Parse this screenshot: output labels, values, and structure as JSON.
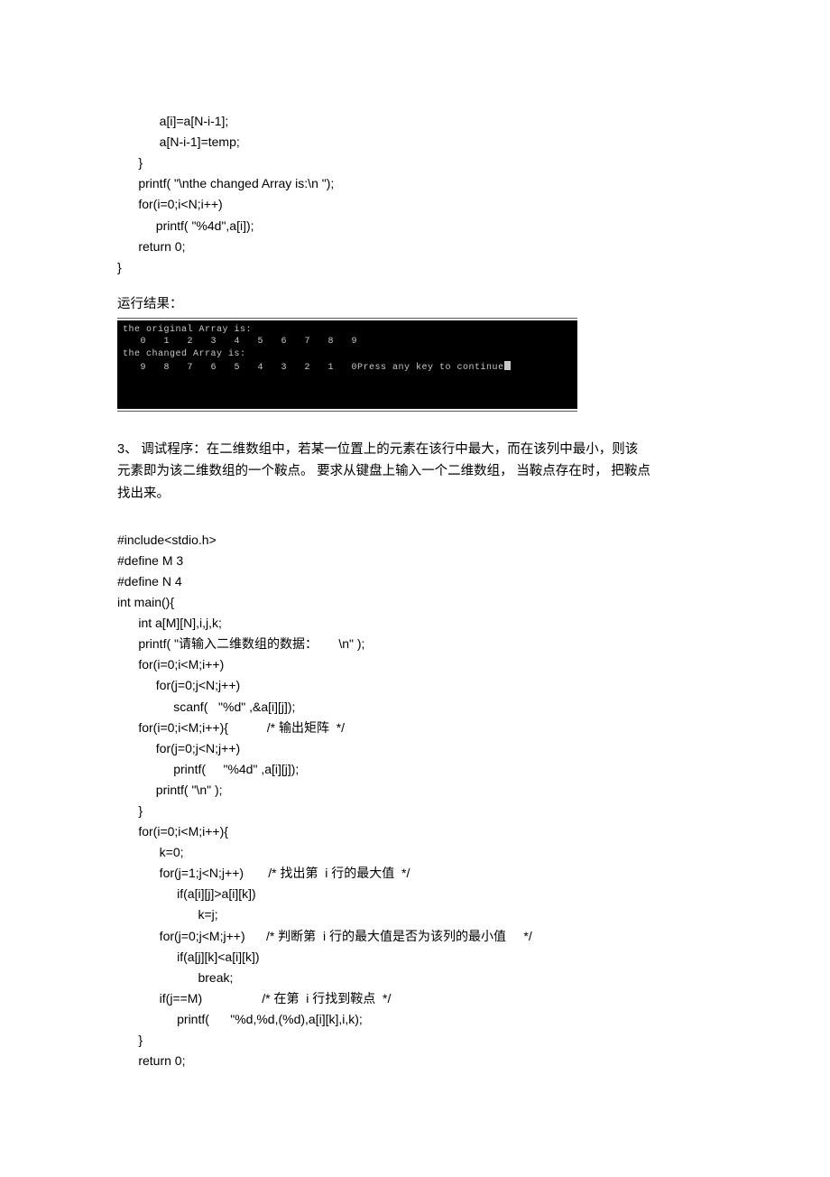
{
  "code_top": [
    "            a[i]=a[N-i-1];",
    "            a[N-i-1]=temp;",
    "      }",
    "      printf( \"\\nthe changed Array is:\\n \");",
    "      for(i=0;i<N;i++)",
    "           printf( \"%4d\",a[i]);",
    "      return 0;",
    "}"
  ],
  "result_label": "运行结果：",
  "console": {
    "line1": "the original Array is:",
    "line2": "   0   1   2   3   4   5   6   7   8   9",
    "line3": "the changed Array is:",
    "line4": "   9   8   7   6   5   4   3   2   1   0Press any key to continue"
  },
  "problem": {
    "num": "3、",
    "text_l1": "调试程序：在二维数组中，若某一位置上的元素在该行中最大，而在该列中最小，则该",
    "text_l2": "元素即为该二维数组的一个鞍点。     要求从键盘上输入一个二维数组，     当鞍点存在时，   把鞍点",
    "text_l3": "找出来。"
  },
  "code_main": [
    "#include<stdio.h>",
    "#define M 3",
    "#define N 4",
    "int main(){",
    "      int a[M][N],i,j,k;",
    "      printf( \"请输入二维数组的数据：      \\n\" );",
    "      for(i=0;i<M;i++)",
    "           for(j=0;j<N;j++)",
    "                scanf(   \"%d\" ,&a[i][j]);",
    "      for(i=0;i<M;i++){           /* 输出矩阵  */",
    "           for(j=0;j<N;j++)",
    "                printf(     \"%4d\" ,a[i][j]);",
    "           printf( \"\\n\" );",
    "      }",
    "      for(i=0;i<M;i++){",
    "            k=0;",
    "            for(j=1;j<N;j++)       /* 找出第  i 行的最大值  */",
    "                 if(a[i][j]>a[i][k])",
    "                       k=j;",
    "            for(j=0;j<M;j++)      /* 判断第  i 行的最大值是否为该列的最小值     */",
    "                 if(a[j][k]<a[i][k])",
    "                       break;",
    "            if(j==M)                 /* 在第  i 行找到鞍点  */",
    "                 printf(      \"%d,%d,(%d),a[i][k],i,k);",
    "      }",
    "      return 0;"
  ]
}
